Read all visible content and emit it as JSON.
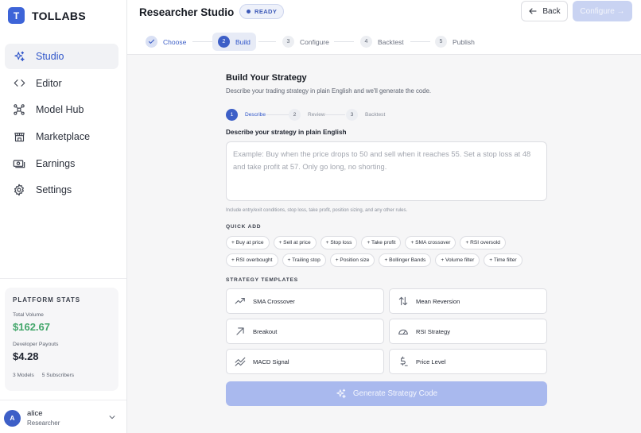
{
  "brand": {
    "logo_letter": "T",
    "name": "TOLLABS"
  },
  "nav": [
    {
      "label": "Studio",
      "icon": "sparkles-icon",
      "active": true
    },
    {
      "label": "Editor",
      "icon": "code-icon"
    },
    {
      "label": "Model Hub",
      "icon": "network-icon"
    },
    {
      "label": "Marketplace",
      "icon": "store-icon"
    },
    {
      "label": "Earnings",
      "icon": "money-icon"
    },
    {
      "label": "Settings",
      "icon": "gear-icon"
    }
  ],
  "stats": {
    "title": "PLATFORM STATS",
    "total_volume_label": "Total Volume",
    "total_volume_value": "$162.67",
    "payouts_label": "Developer Payouts",
    "payouts_value": "$4.28",
    "models": "3 Models",
    "subscribers": "5 Subscribers"
  },
  "user": {
    "initial": "A",
    "name": "alice",
    "role": "Researcher"
  },
  "header": {
    "title": "Researcher Studio",
    "status": "READY",
    "back_label": "Back",
    "configure_label": "Configure →"
  },
  "steps": [
    {
      "num": "1",
      "label": "Choose",
      "state": "done"
    },
    {
      "num": "2",
      "label": "Build",
      "state": "active"
    },
    {
      "num": "3",
      "label": "Configure"
    },
    {
      "num": "4",
      "label": "Backtest"
    },
    {
      "num": "5",
      "label": "Publish"
    }
  ],
  "build": {
    "title": "Build Your Strategy",
    "subtitle": "Describe your trading strategy in plain English and we'll generate the code.",
    "mini_steps": [
      {
        "num": "1",
        "label": "Describe",
        "active": true
      },
      {
        "num": "2",
        "label": "Review"
      },
      {
        "num": "3",
        "label": "Backtest"
      }
    ],
    "field_label": "Describe your strategy in plain English",
    "placeholder": "Example: Buy when the price drops to 50 and sell when it reaches 55. Set a stop loss at 48 and take profit at 57. Only go long, no shorting.",
    "hint": "Include entry/exit conditions, stop loss, take profit, position sizing, and any other rules.",
    "quick_add_title": "QUICK ADD",
    "quick_add_row1": [
      "+ Buy at price",
      "+ Sell at price",
      "+ Stop loss",
      "+ Take profit",
      "+ SMA crossover",
      "+ RSI oversold"
    ],
    "quick_add_row2": [
      "+ RSI overbought",
      "+ Trailing stop",
      "+ Position size",
      "+ Bollinger Bands",
      "+ Volume filter",
      "+ Time filter"
    ],
    "templates_title": "STRATEGY TEMPLATES",
    "templates": [
      {
        "label": "SMA Crossover",
        "icon": "trend-up-icon"
      },
      {
        "label": "Mean Reversion",
        "icon": "arrows-updown-icon"
      },
      {
        "label": "Breakout",
        "icon": "arrow-up-right-icon"
      },
      {
        "label": "RSI Strategy",
        "icon": "gauge-icon"
      },
      {
        "label": "MACD Signal",
        "icon": "wave-lines-icon"
      },
      {
        "label": "Price Level",
        "icon": "dollar-icon"
      }
    ],
    "generate_label": "Generate Strategy Code"
  },
  "colors": {
    "accent": "#3d5fc7",
    "success": "#42a66a",
    "button_disabled": "#a9b9ee"
  }
}
